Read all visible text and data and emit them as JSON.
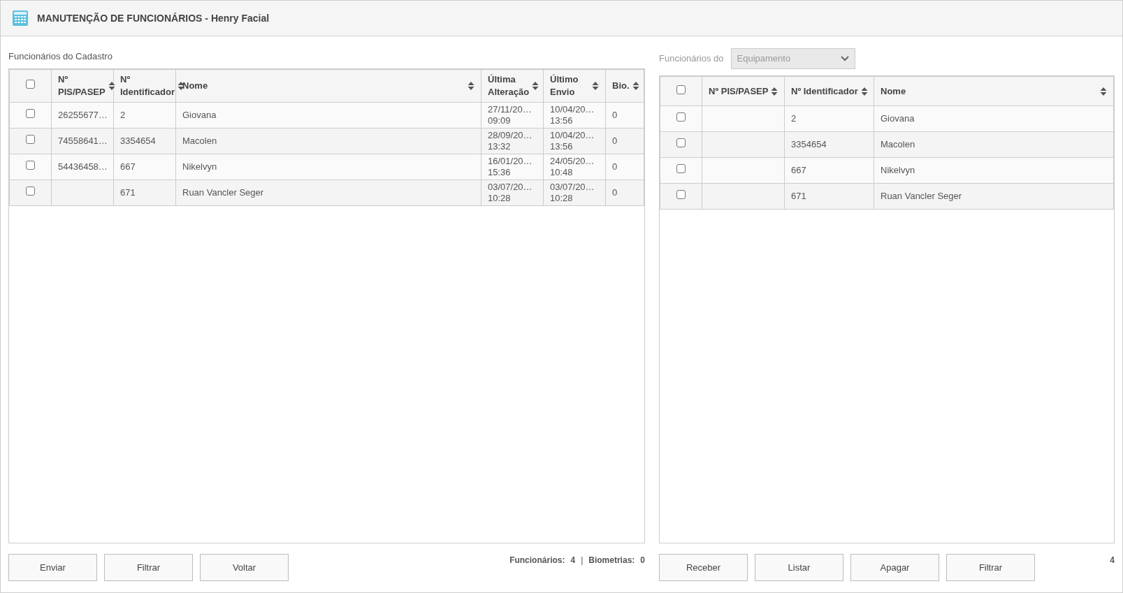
{
  "window": {
    "title": "MANUTENÇÃO DE FUNCIONÁRIOS - Henry Facial"
  },
  "left_panel": {
    "label": "Funcionários do Cadastro",
    "table": {
      "select_all": {
        "checked": false
      },
      "columns": [
        {
          "label": "Nº PIS/PASEP",
          "sortable": true
        },
        {
          "label": "Nº Identificador",
          "sortable": true
        },
        {
          "label": "Nome",
          "sortable": true
        },
        {
          "label": "Última Alteração",
          "sortable": true
        },
        {
          "label": "Último Envio",
          "sortable": true
        },
        {
          "label": "Bio.",
          "sortable": true
        }
      ],
      "rows": [
        {
          "checked": false,
          "cells": [
            "26255677…",
            "2",
            "Giovana",
            "27/11/20…\n09:09",
            "10/04/20…\n13:56",
            "0"
          ]
        },
        {
          "checked": false,
          "cells": [
            "74558641…",
            "3354654",
            "Macolen",
            "28/09/20…\n13:32",
            "10/04/20…\n13:56",
            "0"
          ]
        },
        {
          "checked": false,
          "cells": [
            "54436458…",
            "667",
            "Nikelvyn",
            "16/01/20…\n15:36",
            "24/05/20…\n10:48",
            "0"
          ]
        },
        {
          "checked": false,
          "cells": [
            "",
            "671",
            "Ruan Vancler Seger",
            "03/07/20…\n10:28",
            "03/07/20…\n10:28",
            "0"
          ]
        }
      ]
    },
    "buttons": [
      "Enviar",
      "Filtrar",
      "Voltar"
    ],
    "summary": [
      {
        "label": "Funcionários:",
        "value": "4"
      },
      {
        "label": "Biometrias:",
        "value": "0"
      }
    ],
    "summary_separator": "|"
  },
  "right_panel": {
    "label": "Funcionários do",
    "source_select": {
      "value": "Equipamento",
      "disabled": true
    },
    "table": {
      "select_all": {
        "checked": false
      },
      "columns": [
        {
          "label": "Nº PIS/PASEP",
          "sortable": true
        },
        {
          "label": "Nº Identificador",
          "sortable": true
        },
        {
          "label": "Nome",
          "sortable": true
        }
      ],
      "rows": [
        {
          "checked": false,
          "cells": [
            "",
            "2",
            "Giovana"
          ]
        },
        {
          "checked": false,
          "cells": [
            "",
            "3354654",
            "Macolen"
          ]
        },
        {
          "checked": false,
          "cells": [
            "",
            "667",
            "Nikelvyn"
          ]
        },
        {
          "checked": false,
          "cells": [
            "",
            "671",
            "Ruan Vancler Seger"
          ]
        }
      ]
    },
    "buttons": [
      "Receber",
      "Listar",
      "Apagar",
      "Filtrar"
    ],
    "count": "4"
  }
}
